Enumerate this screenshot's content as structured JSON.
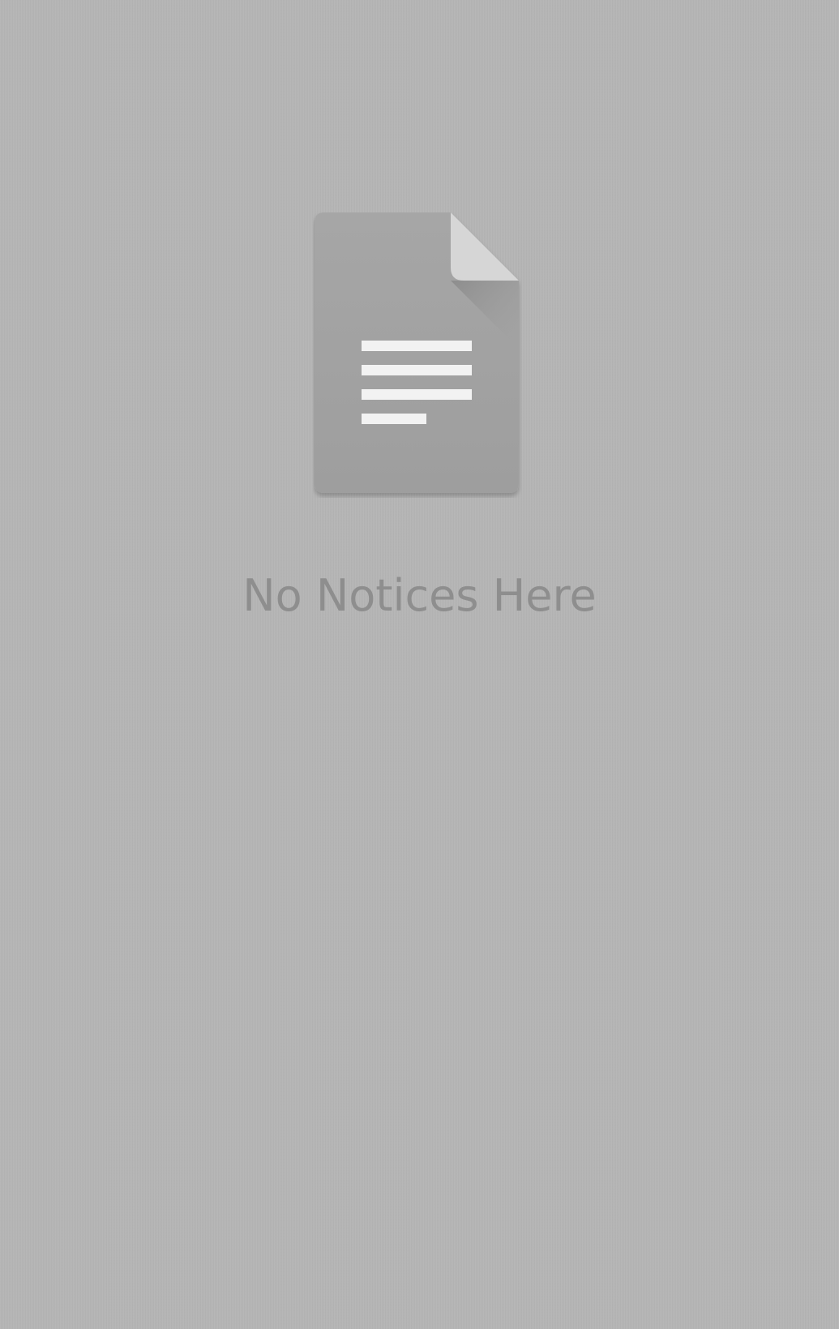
{
  "empty_state": {
    "icon": "document-icon",
    "message": "No Notices Here"
  },
  "colors": {
    "background": "#b5b5b5",
    "icon_body": "#a2a2a2",
    "icon_fold": "#d8d8d8",
    "icon_lines": "#f0f0f0",
    "message_text": "#8e8e8e"
  }
}
